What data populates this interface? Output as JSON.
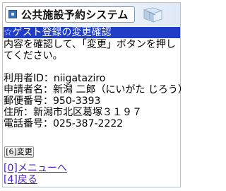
{
  "header": {
    "title": "公共施設予約システム"
  },
  "section": {
    "title": "☆ゲスト登録の変更確認"
  },
  "instructions": "内容を確認して、「変更」ボタンを押してください。",
  "fields": {
    "user_id": "利用者ID：niigataziro",
    "applicant": "申請者名：新潟 二郎（にいがた じろう）",
    "postal": "郵便番号：950-3393",
    "address": "住所：新潟市北区葛塚３１９７",
    "phone": "電話番号：025-387-2222"
  },
  "actions": {
    "change_button": "[6]変更"
  },
  "links": {
    "menu": "[0]メニューへ",
    "back": "[4]戻る"
  },
  "colors": {
    "section_bar": "#1f3dc7",
    "link": "#4b1fc6"
  }
}
